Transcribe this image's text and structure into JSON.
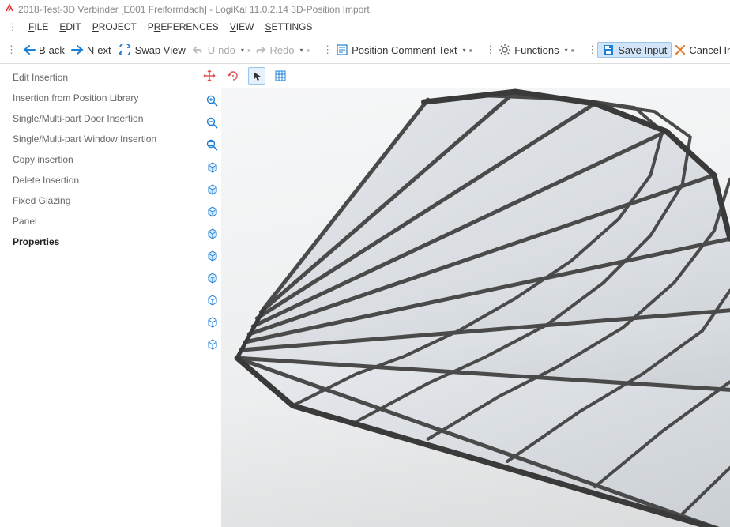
{
  "window": {
    "title": "2018-Test-3D Verbinder [E001 Freiformdach] - LogiKal 11.0.2.14 3D-Position Import"
  },
  "menu": {
    "file": "FILE",
    "edit": "EDIT",
    "project": "PROJECT",
    "preferences": "PREFERENCES",
    "view": "VIEW",
    "settings": "SETTINGS"
  },
  "toolbar": {
    "back": "Back",
    "next": "Next",
    "swap": "Swap View",
    "undo": "Undo",
    "redo": "Redo",
    "position_comment": "Position Comment Text",
    "functions": "Functions",
    "save_input": "Save Input",
    "cancel_input": "Cancel Input of Elements"
  },
  "sidebar": {
    "items": [
      {
        "label": "Edit Insertion"
      },
      {
        "label": "Insertion from Position Library"
      },
      {
        "label": "Single/Multi-part Door Insertion"
      },
      {
        "label": "Single/Multi-part Window Insertion"
      },
      {
        "label": "Copy insertion"
      },
      {
        "label": "Delete Insertion"
      },
      {
        "label": "Fixed Glazing"
      },
      {
        "label": "Panel"
      },
      {
        "label": "Properties"
      }
    ],
    "active_index": 8
  },
  "canvas_h": {
    "move": "move-tool",
    "rotate": "rotate-tool",
    "select": "select-tool",
    "grid": "grid-tool"
  },
  "canvas_v": {
    "zoom_in": "zoom-in",
    "zoom_out": "zoom-out",
    "zoom_fit": "zoom-fit",
    "views": [
      "front",
      "back",
      "left",
      "right",
      "top",
      "bottom",
      "iso1",
      "iso2",
      "iso3"
    ]
  }
}
